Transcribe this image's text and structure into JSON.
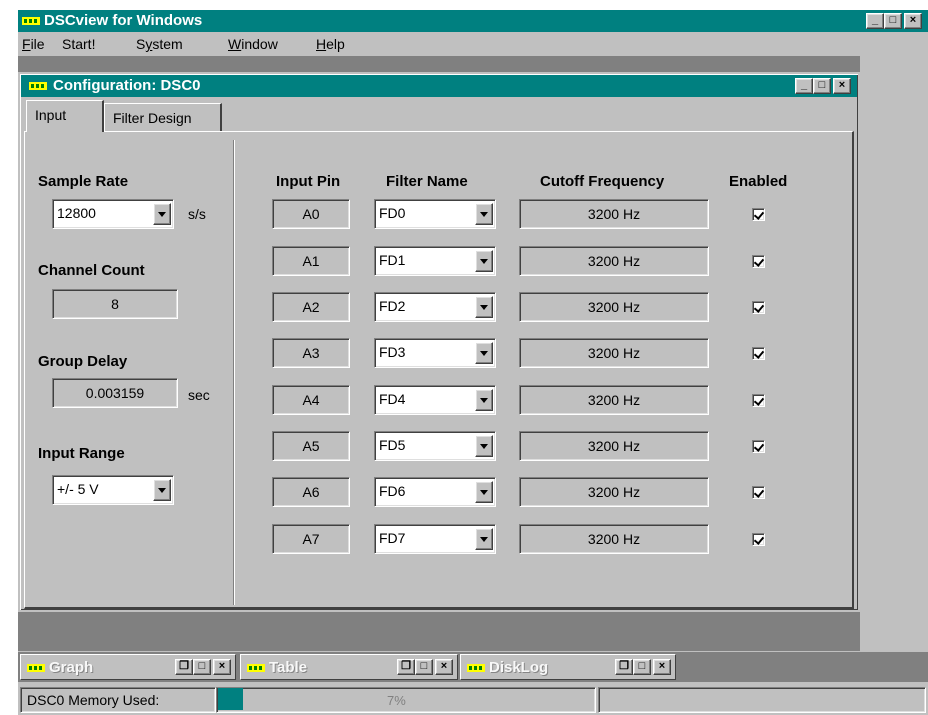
{
  "app": {
    "title": "DSCview for Windows",
    "menu": [
      "File",
      "Start!",
      "System",
      "Window",
      "Help"
    ],
    "menu_mnemonics": [
      "F",
      "",
      "y",
      "W",
      "H"
    ],
    "accent_color": "#008080",
    "minimize_glyph": "_",
    "maximize_glyph": "□",
    "close_glyph": "×",
    "restore_glyph": "❐"
  },
  "config_window": {
    "title": "Configuration: DSC0",
    "tabs": [
      "Input",
      "Filter Design"
    ],
    "active_tab": "Input",
    "sample_rate": {
      "label": "Sample Rate",
      "value": "12800",
      "unit": "s/s"
    },
    "channel_count": {
      "label": "Channel Count",
      "value": "8"
    },
    "group_delay": {
      "label": "Group Delay",
      "value": "0.003159",
      "unit": "sec"
    },
    "input_range": {
      "label": "Input Range",
      "value": "+/- 5 V"
    },
    "table": {
      "headers": [
        "Input Pin",
        "Filter Name",
        "Cutoff Frequency",
        "Enabled"
      ],
      "rows": [
        {
          "pin": "A0",
          "filter": "FD0",
          "cutoff": "3200 Hz",
          "enabled": true
        },
        {
          "pin": "A1",
          "filter": "FD1",
          "cutoff": "3200 Hz",
          "enabled": true
        },
        {
          "pin": "A2",
          "filter": "FD2",
          "cutoff": "3200 Hz",
          "enabled": true
        },
        {
          "pin": "A3",
          "filter": "FD3",
          "cutoff": "3200 Hz",
          "enabled": true
        },
        {
          "pin": "A4",
          "filter": "FD4",
          "cutoff": "3200 Hz",
          "enabled": true
        },
        {
          "pin": "A5",
          "filter": "FD5",
          "cutoff": "3200 Hz",
          "enabled": true
        },
        {
          "pin": "A6",
          "filter": "FD6",
          "cutoff": "3200 Hz",
          "enabled": true
        },
        {
          "pin": "A7",
          "filter": "FD7",
          "cutoff": "3200 Hz",
          "enabled": true
        }
      ]
    }
  },
  "minimized_windows": [
    "Graph",
    "Table",
    "DiskLog"
  ],
  "status": {
    "memory_label": "DSC0 Memory Used:",
    "memory_percent_text": "7%",
    "memory_fraction": 0.07
  }
}
